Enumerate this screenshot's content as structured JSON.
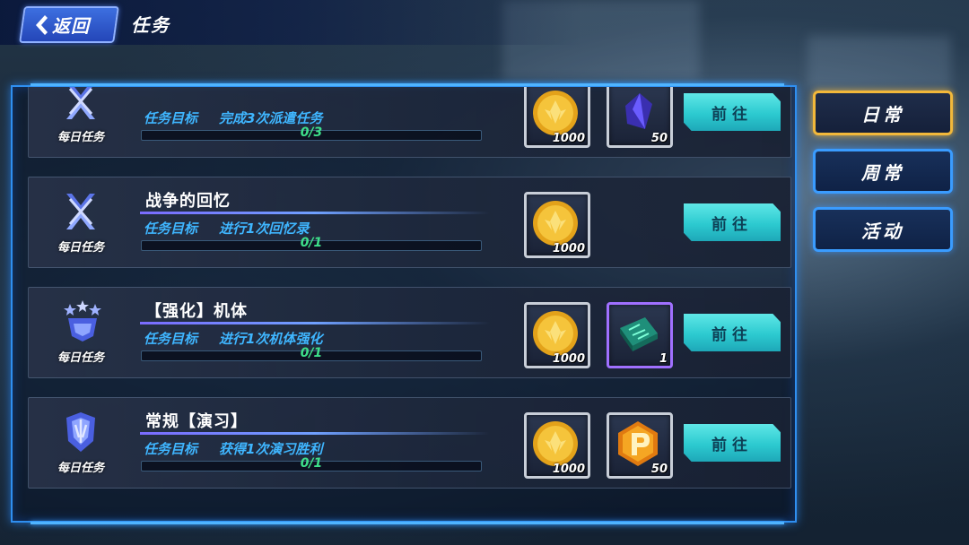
{
  "header": {
    "back_label": "返回",
    "title": "任务"
  },
  "tabs": [
    {
      "label": "日常",
      "active": true
    },
    {
      "label": "周常",
      "active": false
    },
    {
      "label": "活动",
      "active": false
    }
  ],
  "tasks": [
    {
      "badge_label": "每日任务",
      "badge_icon": "crossed-swords-icon",
      "title": "",
      "goal_label": "任务目标",
      "goal_text": "完成3次派遣任务",
      "progress_text": "0/3",
      "progress": 0,
      "rewards": [
        {
          "icon": "gold-coin-icon",
          "count": "1000"
        },
        {
          "icon": "blue-crystal-icon",
          "count": "50"
        }
      ],
      "go_label": "前往"
    },
    {
      "badge_label": "每日任务",
      "badge_icon": "crossed-swords-icon",
      "title": "战争的回忆",
      "goal_label": "任务目标",
      "goal_text": "进行1次回忆录",
      "progress_text": "0/1",
      "progress": 0,
      "rewards": [
        {
          "icon": "gold-coin-icon",
          "count": "1000"
        }
      ],
      "go_label": "前往"
    },
    {
      "badge_label": "每日任务",
      "badge_icon": "three-stars-icon",
      "title": "【强化】机体",
      "goal_label": "任务目标",
      "goal_text": "进行1次机体强化",
      "progress_text": "0/1",
      "progress": 0,
      "rewards": [
        {
          "icon": "gold-coin-icon",
          "count": "1000"
        },
        {
          "icon": "circuit-chip-icon",
          "count": "1"
        }
      ],
      "go_label": "前往"
    },
    {
      "badge_label": "每日任务",
      "badge_icon": "mech-helmet-icon",
      "title": "常规【演习】",
      "goal_label": "任务目标",
      "goal_text": "获得1次演习胜利",
      "progress_text": "0/1",
      "progress": 0,
      "rewards": [
        {
          "icon": "gold-coin-icon",
          "count": "1000"
        },
        {
          "icon": "p-token-icon",
          "count": "50"
        }
      ],
      "go_label": "前往"
    }
  ],
  "colors": {
    "accent_blue": "#3a9cff",
    "active_tab": "#f2b83a",
    "go_button": "#2ccad0",
    "goal_text": "#3fb6ff",
    "progress_text": "#3ee08a"
  }
}
